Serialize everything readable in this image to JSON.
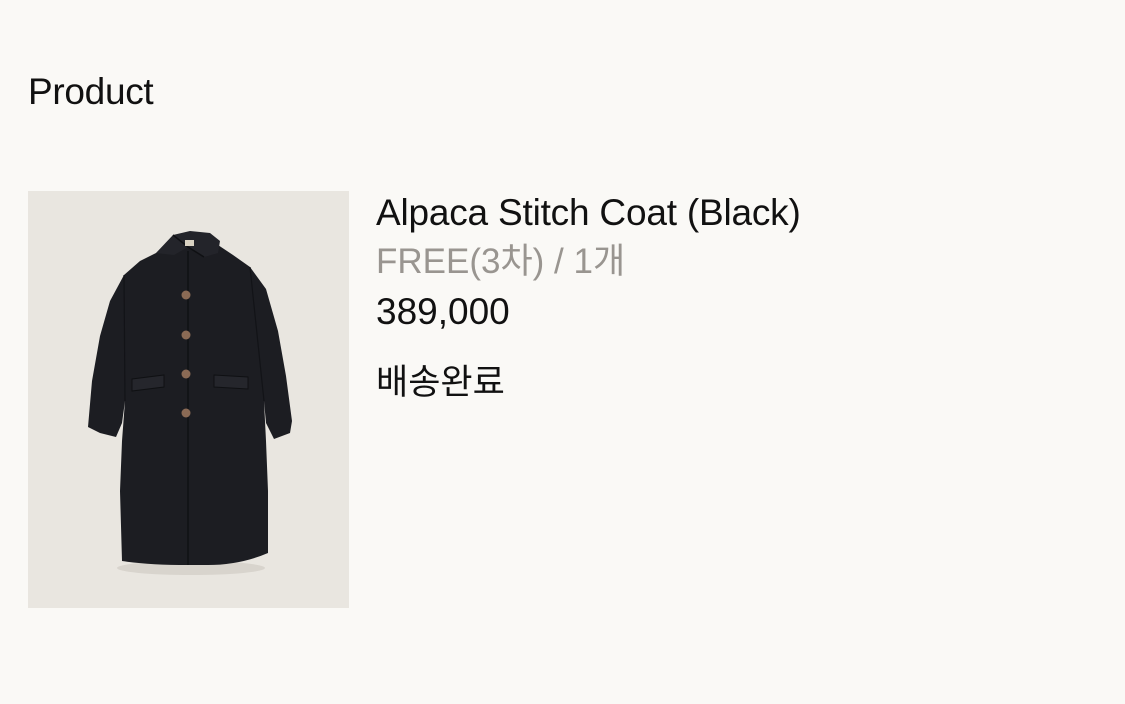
{
  "section": {
    "title": "Product"
  },
  "product": {
    "name": "Alpaca Stitch Coat (Black)",
    "option": "FREE(3차) / 1개",
    "price": "389,000",
    "status": "배송완료",
    "image_alt": "Alpaca Stitch Coat (Black)"
  },
  "colors": {
    "background": "#faf9f6",
    "text": "#111111",
    "muted_text": "#999590",
    "image_background": "#e9e6e0",
    "coat": "#1c1d22",
    "buttons": "#8a6a55"
  }
}
